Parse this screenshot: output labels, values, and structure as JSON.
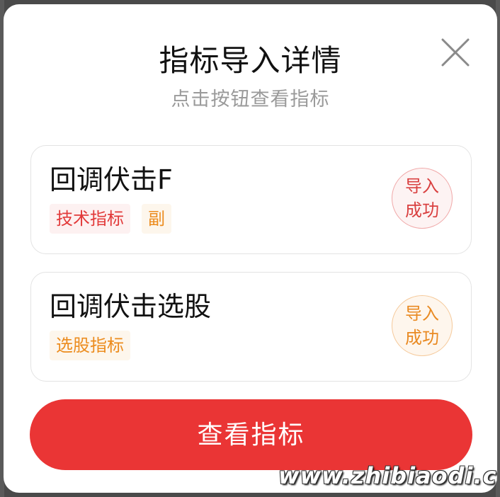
{
  "modal": {
    "title": "指标导入详情",
    "subtitle": "点击按钮查看指标",
    "close_icon": "close-icon"
  },
  "indicators": [
    {
      "name": "回调伏击F",
      "tags": [
        {
          "label": "技术指标",
          "color": "#e23a3a"
        },
        {
          "label": "副",
          "color": "#ec8c1e"
        }
      ],
      "stamp": {
        "line1": "导入",
        "line2": "成功",
        "color": "#d94040"
      }
    },
    {
      "name": "回调伏击选股",
      "tags": [
        {
          "label": "选股指标",
          "color": "#ec8c1e"
        }
      ],
      "stamp": {
        "line1": "导入",
        "line2": "成功",
        "color": "#e98a22"
      }
    }
  ],
  "cta": {
    "label": "查看指标",
    "color": "#ea3535"
  },
  "watermark": "www.zhibiaodi.com"
}
